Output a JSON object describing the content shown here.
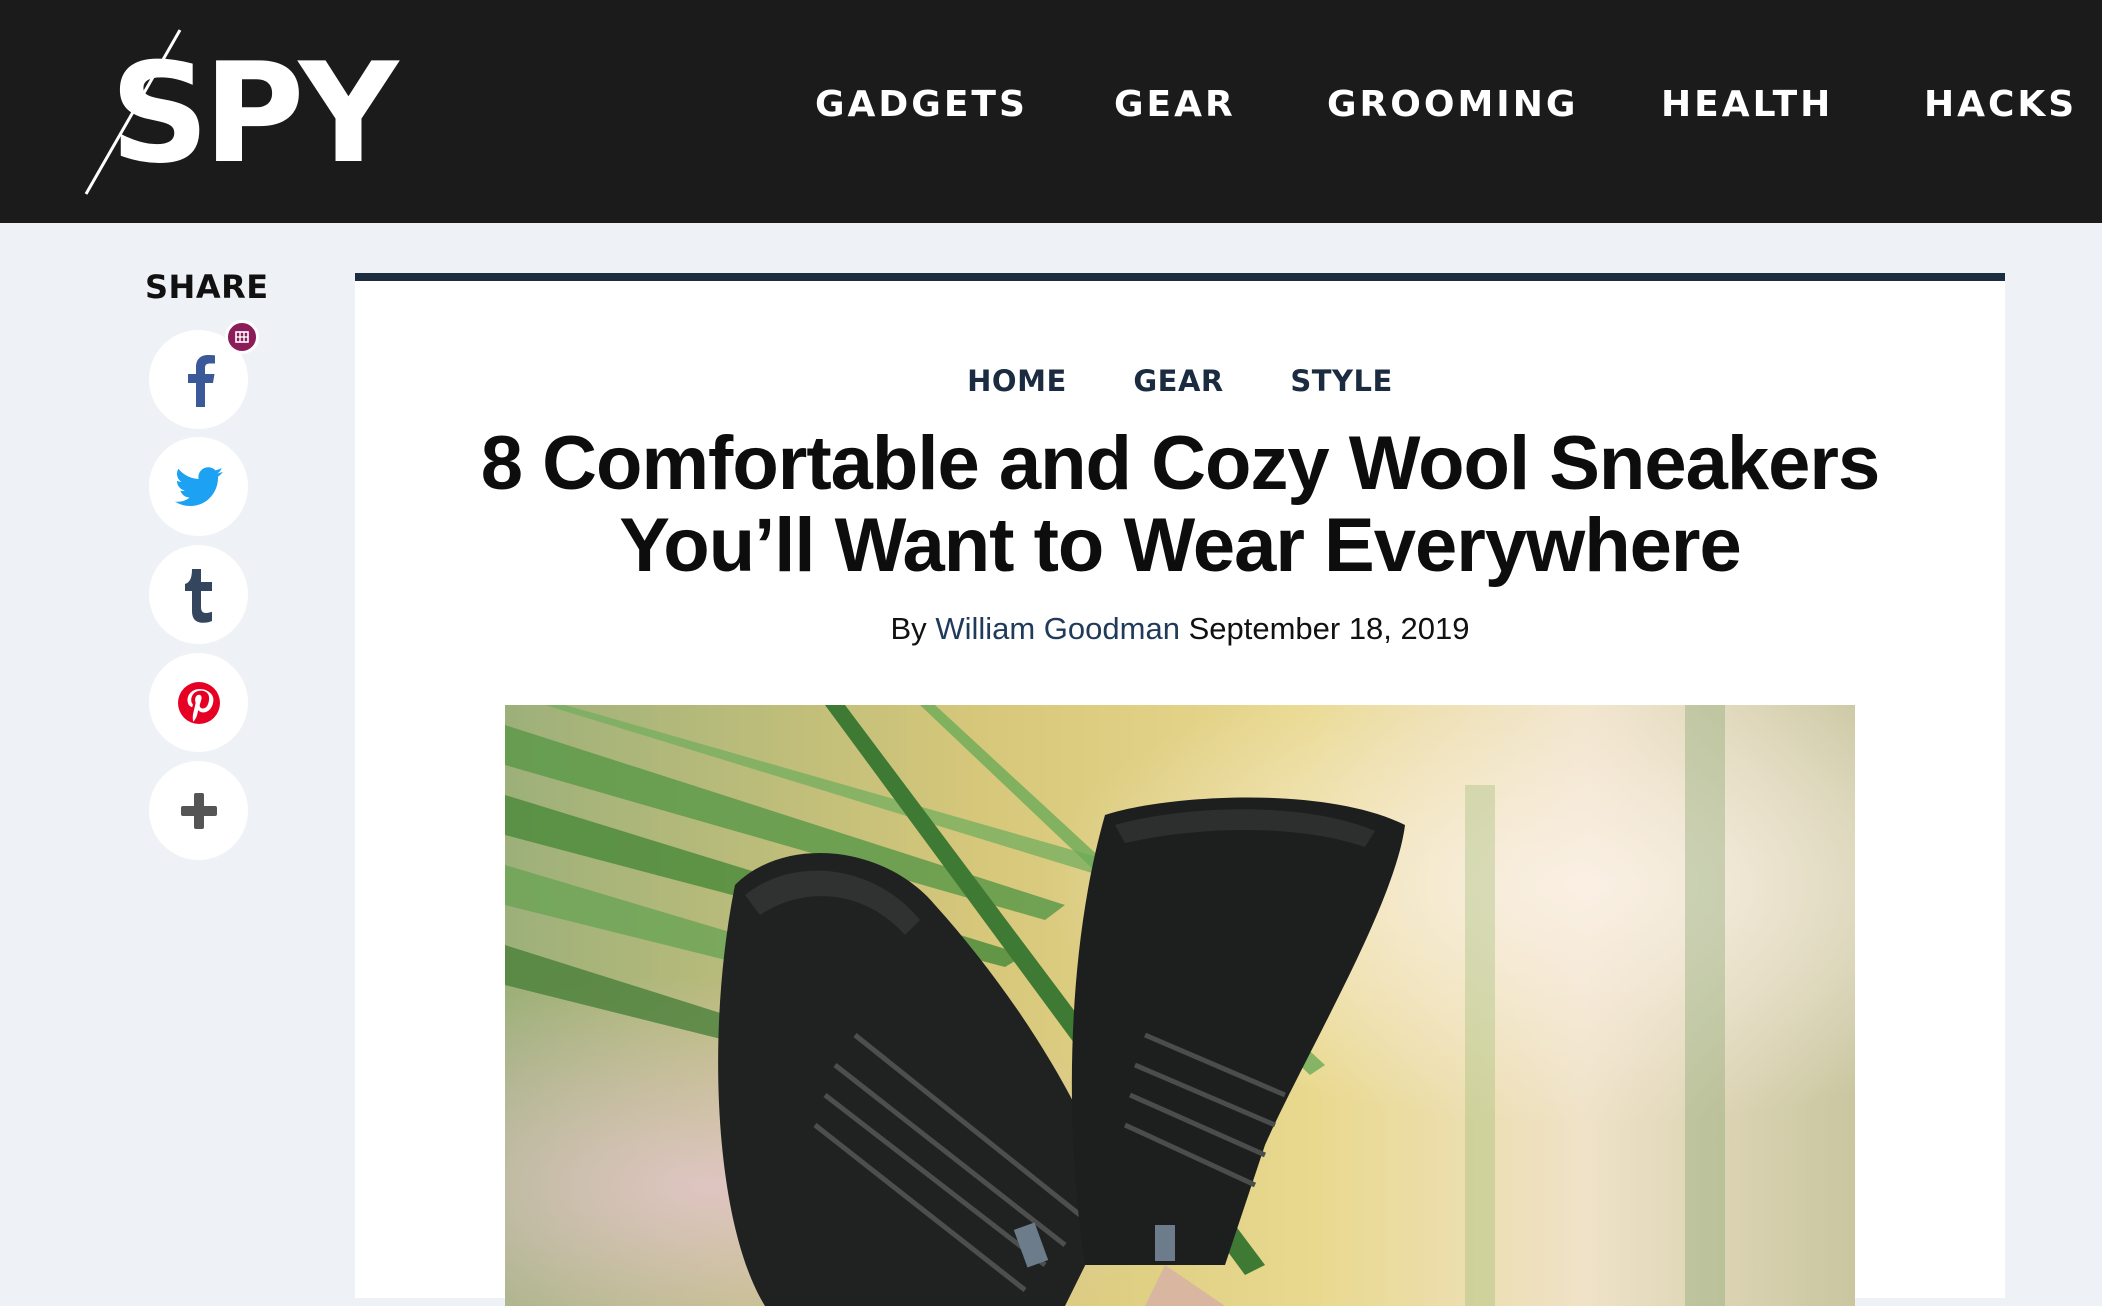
{
  "site": {
    "logo_text": "SPY",
    "nav": [
      "GADGETS",
      "GEAR",
      "GROOMING",
      "HEALTH",
      "HACKS"
    ]
  },
  "share": {
    "label": "SHARE",
    "buttons": [
      {
        "icon": "facebook-icon",
        "glyph": "f",
        "color": "#3b5998"
      },
      {
        "icon": "twitter-icon",
        "color": "#1da1f2"
      },
      {
        "icon": "tumblr-icon",
        "glyph": "t",
        "color": "#34465d"
      },
      {
        "icon": "pinterest-icon",
        "color": "#e60023"
      },
      {
        "icon": "plus-icon",
        "glyph": "+",
        "color": "#555555"
      }
    ]
  },
  "article": {
    "breadcrumbs": [
      "HOME",
      "GEAR",
      "STYLE"
    ],
    "title": "8 Comfortable and Cozy Wool Sneakers You’ll Want to Wear Everywhere",
    "byline_prefix": "By",
    "author": "William Goodman",
    "date": "September 18, 2019",
    "hero_image": "black wool sneakers among green leaves"
  },
  "colors": {
    "header_bg": "#1b1b1c",
    "page_bg": "#eef2f7",
    "card_accent": "#1c2d40",
    "author_link": "#1f3a5a"
  }
}
